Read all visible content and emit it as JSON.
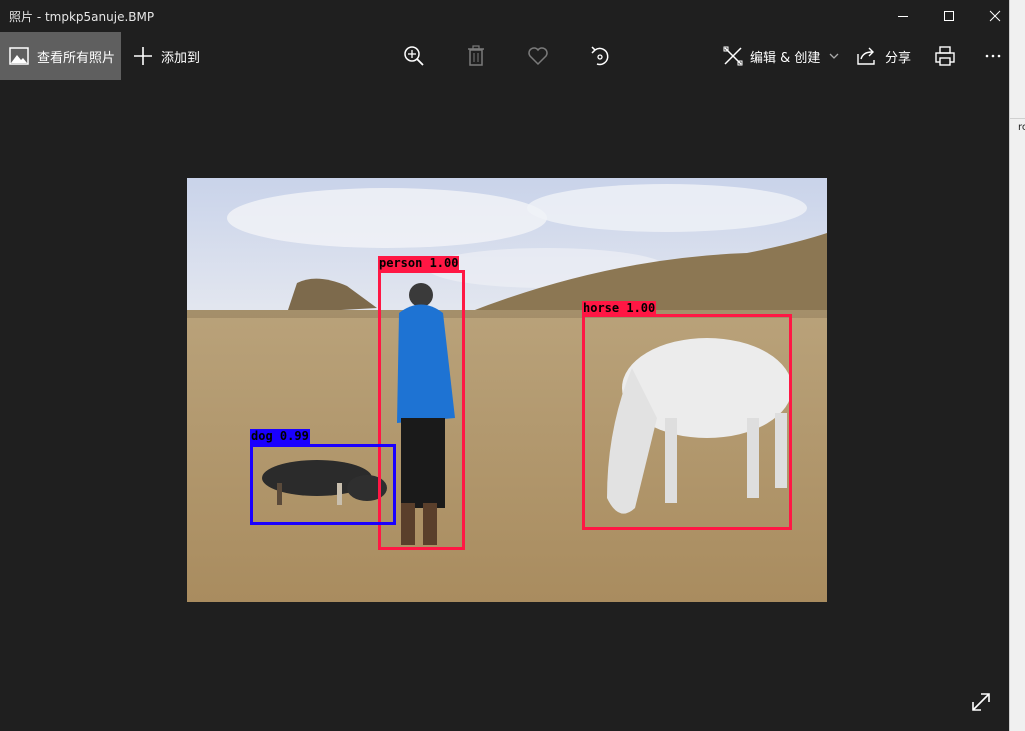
{
  "window": {
    "title": "照片 - tmpkp5anuje.BMP"
  },
  "toolbar": {
    "all_photos_label": "查看所有照片",
    "add_to_label": "添加到",
    "edit_create_label": "编辑 & 创建",
    "share_label": "分享",
    "icons": [
      "zoom-in-icon",
      "delete-icon",
      "favorite-icon",
      "rotate-icon",
      "print-icon",
      "more-icon"
    ]
  },
  "right_strip": {
    "fragment": "rc"
  },
  "photo": {
    "filename": "tmpkp5anuje.BMP",
    "detections": [
      {
        "label": "person 1.00",
        "color": "#ff1744"
      },
      {
        "label": "horse 1.00",
        "color": "#ff1744"
      },
      {
        "label": "dog 0.99",
        "color": "#1a00ff"
      }
    ]
  },
  "colors": {
    "background": "#1f1f1f",
    "toolbar_selected": "#5f5f5f",
    "person_box": "#ff1744",
    "dog_box": "#1a00ff"
  }
}
